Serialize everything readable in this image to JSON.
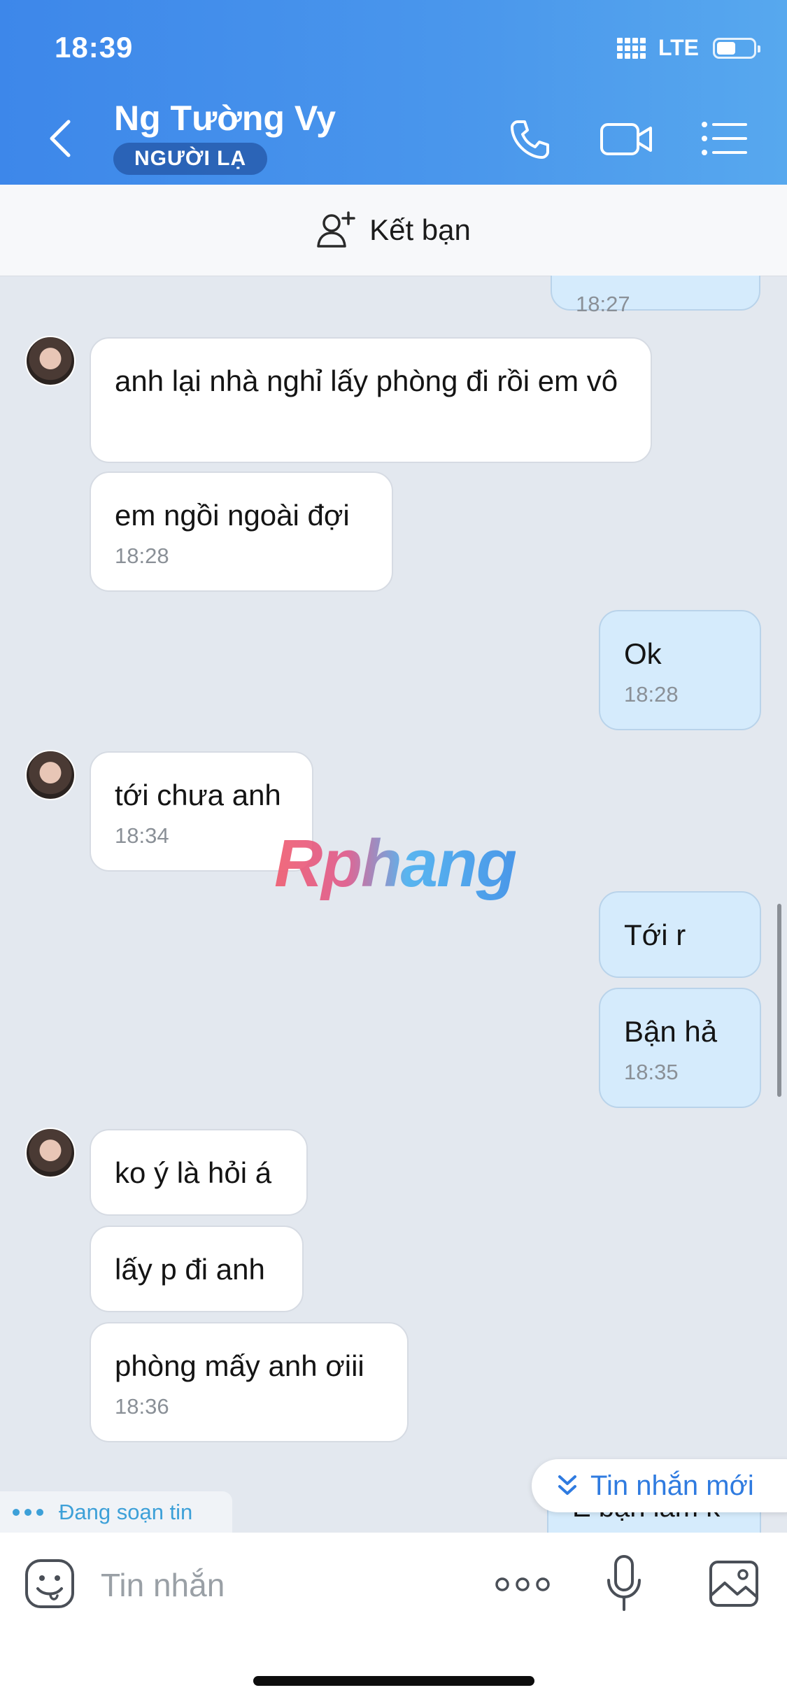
{
  "status_bar": {
    "time": "18:39",
    "network": "LTE"
  },
  "header": {
    "contact_name": "Ng Tường Vy",
    "badge": "NGƯỜI LẠ",
    "icons": [
      "back-icon",
      "phone-icon",
      "video-call-icon",
      "menu-list-icon"
    ]
  },
  "add_friend": {
    "label": "Kết bạn"
  },
  "messages": [
    {
      "dir": "out",
      "text": "",
      "time": "18:27"
    },
    {
      "dir": "in",
      "text": "anh lại nhà nghỉ lấy phòng đi rồi em vô",
      "time": ""
    },
    {
      "dir": "in",
      "text": "em ngồi ngoài đợi",
      "time": "18:28"
    },
    {
      "dir": "out",
      "text": "Ok",
      "time": "18:28"
    },
    {
      "dir": "in",
      "text": "tới chưa anh",
      "time": "18:34"
    },
    {
      "dir": "out",
      "text": "Tới r",
      "time": ""
    },
    {
      "dir": "out",
      "text": "Bận hả",
      "time": "18:35"
    },
    {
      "dir": "in",
      "text": "ko ý là hỏi á",
      "time": ""
    },
    {
      "dir": "in",
      "text": "lấy p đi anh",
      "time": ""
    },
    {
      "dir": "in",
      "text": "phòng mấy anh ơiii",
      "time": "18:36"
    },
    {
      "dir": "out",
      "text": "E bận lắm k",
      "time": ""
    }
  ],
  "watermark": "Rphang",
  "new_message_pill": "Tin nhắn mới",
  "typing_indicator": "Đang soạn tin",
  "composer": {
    "placeholder": "Tin nhắn"
  },
  "colors": {
    "header_start": "#3d87ea",
    "header_end": "#57a8ee",
    "outgoing_bubble": "#d5ebfc",
    "incoming_bubble": "#ffffff",
    "chat_background": "#e3e8ef",
    "accent": "#2f7be0"
  }
}
